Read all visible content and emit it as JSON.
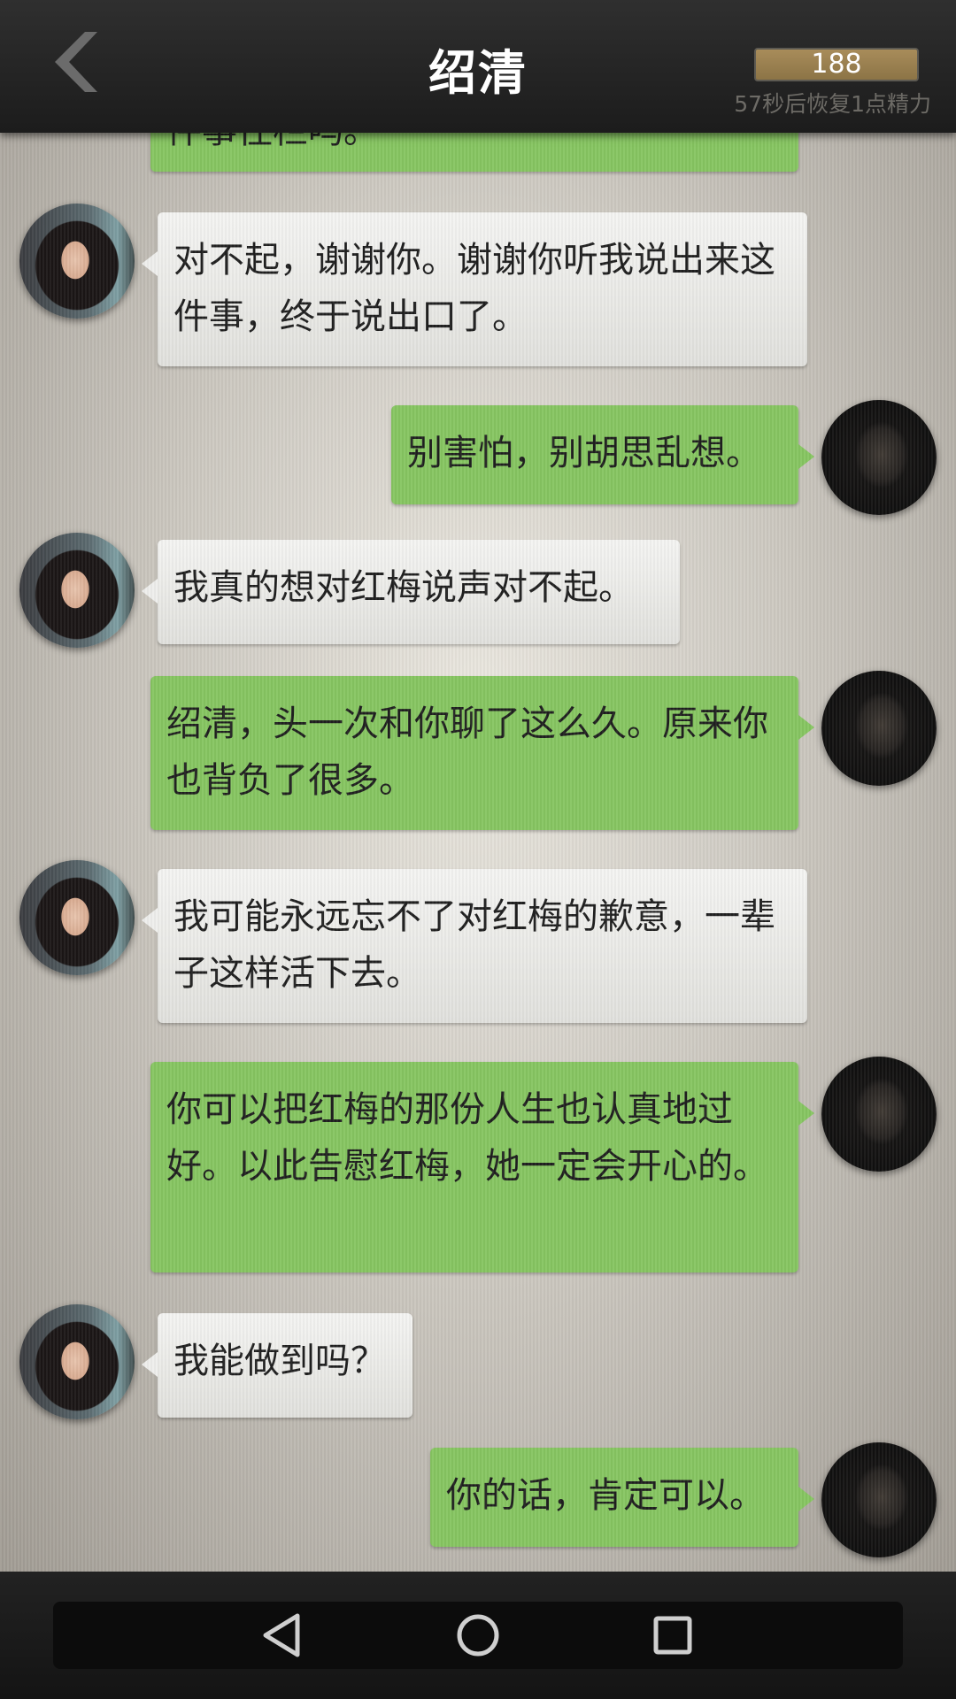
{
  "header": {
    "title": "绍清",
    "energy_value": "188",
    "energy_note": "57秒后恢复1点精力"
  },
  "messages": [
    {
      "sender": "player",
      "text": "件事往栏吗。"
    },
    {
      "sender": "npc",
      "text": "对不起，谢谢你。谢谢你听我说出来这件事，终于说出口了。"
    },
    {
      "sender": "player",
      "text": "别害怕，别胡思乱想。"
    },
    {
      "sender": "npc",
      "text": "我真的想对红梅说声对不起。"
    },
    {
      "sender": "player",
      "text": "绍清，头一次和你聊了这么久。原来你也背负了很多。"
    },
    {
      "sender": "npc",
      "text": "我可能永远忘不了对红梅的歉意，一辈子这样活下去。"
    },
    {
      "sender": "player",
      "text": "你可以把红梅的那份人生也认真地过好。以此告慰红梅，她一定会开心的。"
    },
    {
      "sender": "npc",
      "text": "我能做到吗？"
    },
    {
      "sender": "player",
      "text": "你的话，肯定可以。"
    }
  ],
  "icons": {
    "back": "chevron-left-icon",
    "nav_back": "triangle-back-icon",
    "nav_home": "circle-home-icon",
    "nav_recents": "square-recents-icon"
  },
  "colors": {
    "player_bubble": "#86c561",
    "npc_bubble": "#eeeeec",
    "header_bg": "#222222",
    "energy_bar": "#a88c5a"
  }
}
